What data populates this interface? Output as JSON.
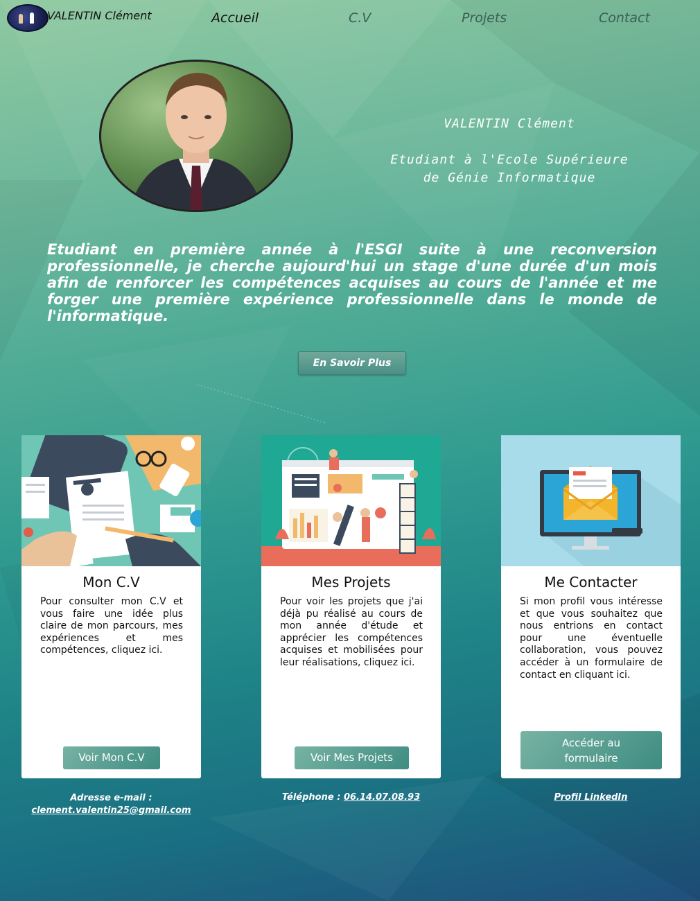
{
  "nav": {
    "brand": "VALENTIN Clément",
    "links": [
      "Accueil",
      "C.V",
      "Projets",
      "Contact"
    ]
  },
  "hero": {
    "name": "VALENTIN Clément",
    "subtitle_line1": "Etudiant à l'Ecole Supérieure",
    "subtitle_line2": "de Génie Informatique",
    "intro": "Etudiant en première année à l'ESGI suite à une reconversion professionnelle, je cherche aujourd'hui un stage d'une durée d'un mois afin de renforcer les compétences acquises au cours de l'année et me forger une première expérience professionnelle dans le monde de l'informatique.",
    "more_button": "En Savoir Plus"
  },
  "cards": [
    {
      "title": "Mon C.V",
      "text": "Pour consulter mon C.V et vous faire une idée plus claire de mon parcours, mes expériences et mes compétences, cliquez ici.",
      "button": "Voir Mon C.V"
    },
    {
      "title": "Mes Projets",
      "text": "Pour voir les projets que j'ai déjà pu réalisé au cours de mon année d'étude et apprécier les compétences acquises et mobilisées pour leur réalisations, cliquez ici.",
      "button": "Voir Mes Projets"
    },
    {
      "title": "Me Contacter",
      "text": "Si mon profil vous intéresse et que vous souhaitez que nous entrions en contact pour une éventuelle collaboration, vous pouvez accéder à un formulaire de contact en cliquant ici.",
      "button_line1": "Accéder au",
      "button_line2": "formulaire"
    }
  ],
  "footer": {
    "email_label": "Adresse e-mail :",
    "email": "clement.valentin25@gmail.com",
    "phone_label": "Téléphone :",
    "phone": "06.14.07.08.93",
    "linkedin": "Profil LinkedIn"
  },
  "colors": {
    "accent_button": "#4a8f86",
    "text_light": "#ffffff"
  }
}
